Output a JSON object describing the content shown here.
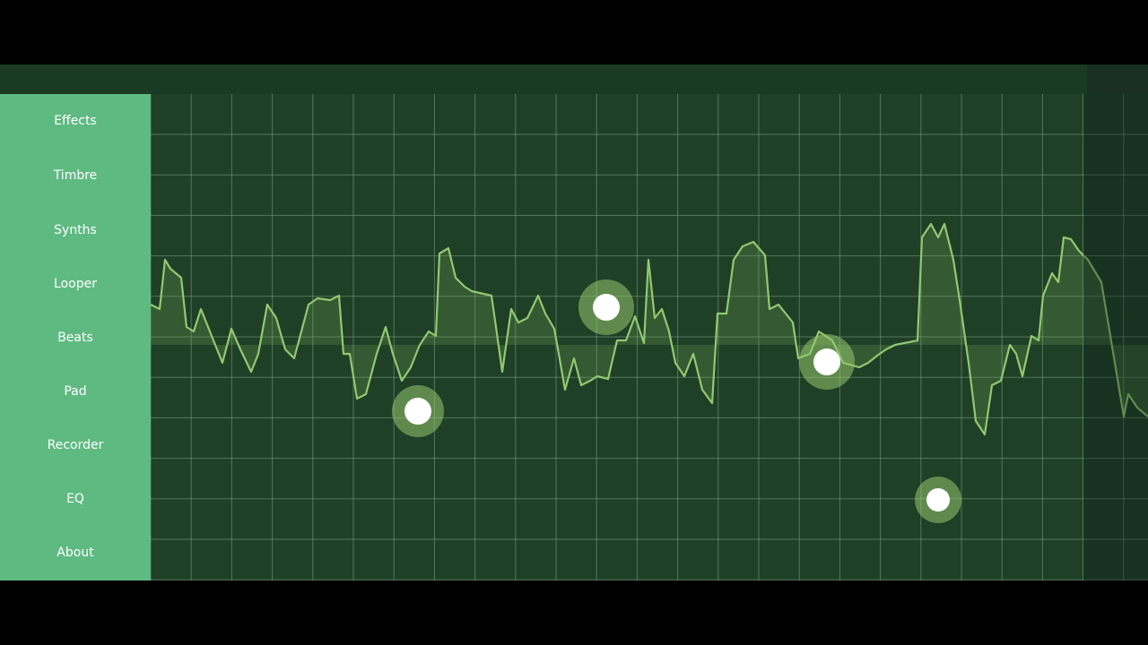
{
  "sidebar": {
    "items": [
      {
        "label": "Effects"
      },
      {
        "label": "Timbre"
      },
      {
        "label": "Synths"
      },
      {
        "label": "Looper"
      },
      {
        "label": "Beats"
      },
      {
        "label": "Pad"
      },
      {
        "label": "Recorder"
      },
      {
        "label": "EQ"
      },
      {
        "label": "About"
      }
    ]
  },
  "theme": {
    "background": "#000000",
    "panel": "#1f3f27",
    "sidebar": "#5fba82",
    "grid_line": "#7fa588",
    "wave": "#93c870",
    "touch_ring": "#8fc36a",
    "touch_dot": "#ffffff"
  },
  "icons": [
    "touch-point-icon"
  ]
}
